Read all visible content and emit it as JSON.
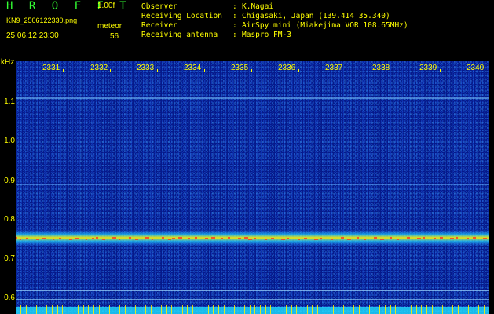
{
  "header": {
    "brand": "H R O F F T",
    "version": "1.00f",
    "filename": "KN9_2506122330.png",
    "datetime": "25.06.12 23:30",
    "meteor_label": "meteor",
    "meteor_count": "56"
  },
  "info": [
    {
      "key": "Observer",
      "sep": ":",
      "value": "K.Nagai"
    },
    {
      "key": "Receiving Location",
      "sep": ":",
      "value": "Chigasaki, Japan (139.414 35.340)"
    },
    {
      "key": "Receiver",
      "sep": ":",
      "value": "AirSpy mini (Miakejima VOR 108.65MHz)"
    },
    {
      "key": "Receiving antenna",
      "sep": ":",
      "value": "Maspro FM-3"
    }
  ],
  "axis": {
    "y_unit": "kHz",
    "y_ticks": [
      "1.1",
      "1.0",
      "0.9",
      "0.8",
      "0.7",
      "0.6"
    ],
    "x_ticks": [
      "2331",
      "2332",
      "2333",
      "2334",
      "2335",
      "2336",
      "2337",
      "2338",
      "2339",
      "2340"
    ]
  },
  "colors": {
    "background": "#000000",
    "label": "#ffff00",
    "brand": "#33ff33",
    "noise_floor": "#061a8a",
    "carrier": "#ffee00",
    "reference_line": "#7ac8ff"
  }
}
